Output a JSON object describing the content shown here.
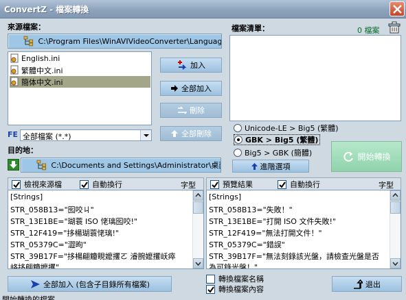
{
  "window": {
    "title": "ConvertZ - 檔案轉換"
  },
  "source": {
    "label": "來源檔案：",
    "path": "C:\\Program Files\\WinAVIVideoConverter\\Language",
    "files": [
      {
        "name": "English.ini",
        "selected": false
      },
      {
        "name": "繁體中文.ini",
        "selected": false
      },
      {
        "name": "簡体中文.ini",
        "selected": true
      }
    ],
    "filter_prefix": "FE",
    "filter_value": "全部檔案 (*.*)"
  },
  "buttons": {
    "add": "加入",
    "add_all": "全部加入",
    "remove": "刪除",
    "remove_all": "全部刪除",
    "advanced": "進階選項",
    "start": "開始轉換",
    "add_all_subdirs": "全部加入 (包含子目錄所有檔案)",
    "exit": "退出"
  },
  "file_list": {
    "label": "檔案清單：",
    "count": "0 檔案"
  },
  "conversion": {
    "options": [
      {
        "label": "Unicode-LE > Big5 (繁體)",
        "selected": false
      },
      {
        "label": "GBK > Big5 (繁體)",
        "selected": true
      },
      {
        "label": "Big5 > GBK (簡體)",
        "selected": false
      }
    ]
  },
  "destination": {
    "label": "目的地：",
    "path": "C:\\Documents and Settings\\Administrator\\桌面"
  },
  "source_panel": {
    "check_view": "檢視來源檔",
    "check_wrap": "自動換行",
    "font_label": "字型",
    "lines": [
      "[Strings]",
      "STR_058B13=\"囮咬ㄐ\"",
      "STR_13E1BE=\"瑚蓑 ISO 恅璃囮咬!\"",
      "STR_12F419=\"拸楊瑚蓑恅璃!\"",
      "STR_05379C=\"澀昫\"",
      "STR_39B17F=\"拸楊翩觼睍嬤攫ㄛ  濬腕嬤攫岆瘁",
      "峈拸翩觼嬤攫\""
    ]
  },
  "preview_panel": {
    "check_preview": "預覽結果",
    "check_wrap": "自動換行",
    "font_label": "字型",
    "lines": [
      "[Strings]",
      "STR_058B13=\"失敗！\"",
      "STR_13E1BE=\"打開 ISO 文件失敗!\"",
      "STR_12F419=\"無法打開文件！\"",
      "STR_05379C=\"錯誤\"",
      "STR_39B17F=\"無法刻錄該光盤，請檢查光盤是否",
      "為可錄光盤！\""
    ]
  },
  "bottom": {
    "convert_names": "轉換檔案名稱",
    "convert_contents": "轉換檔案內容"
  },
  "status": {
    "text": "開始轉換的檔案"
  }
}
